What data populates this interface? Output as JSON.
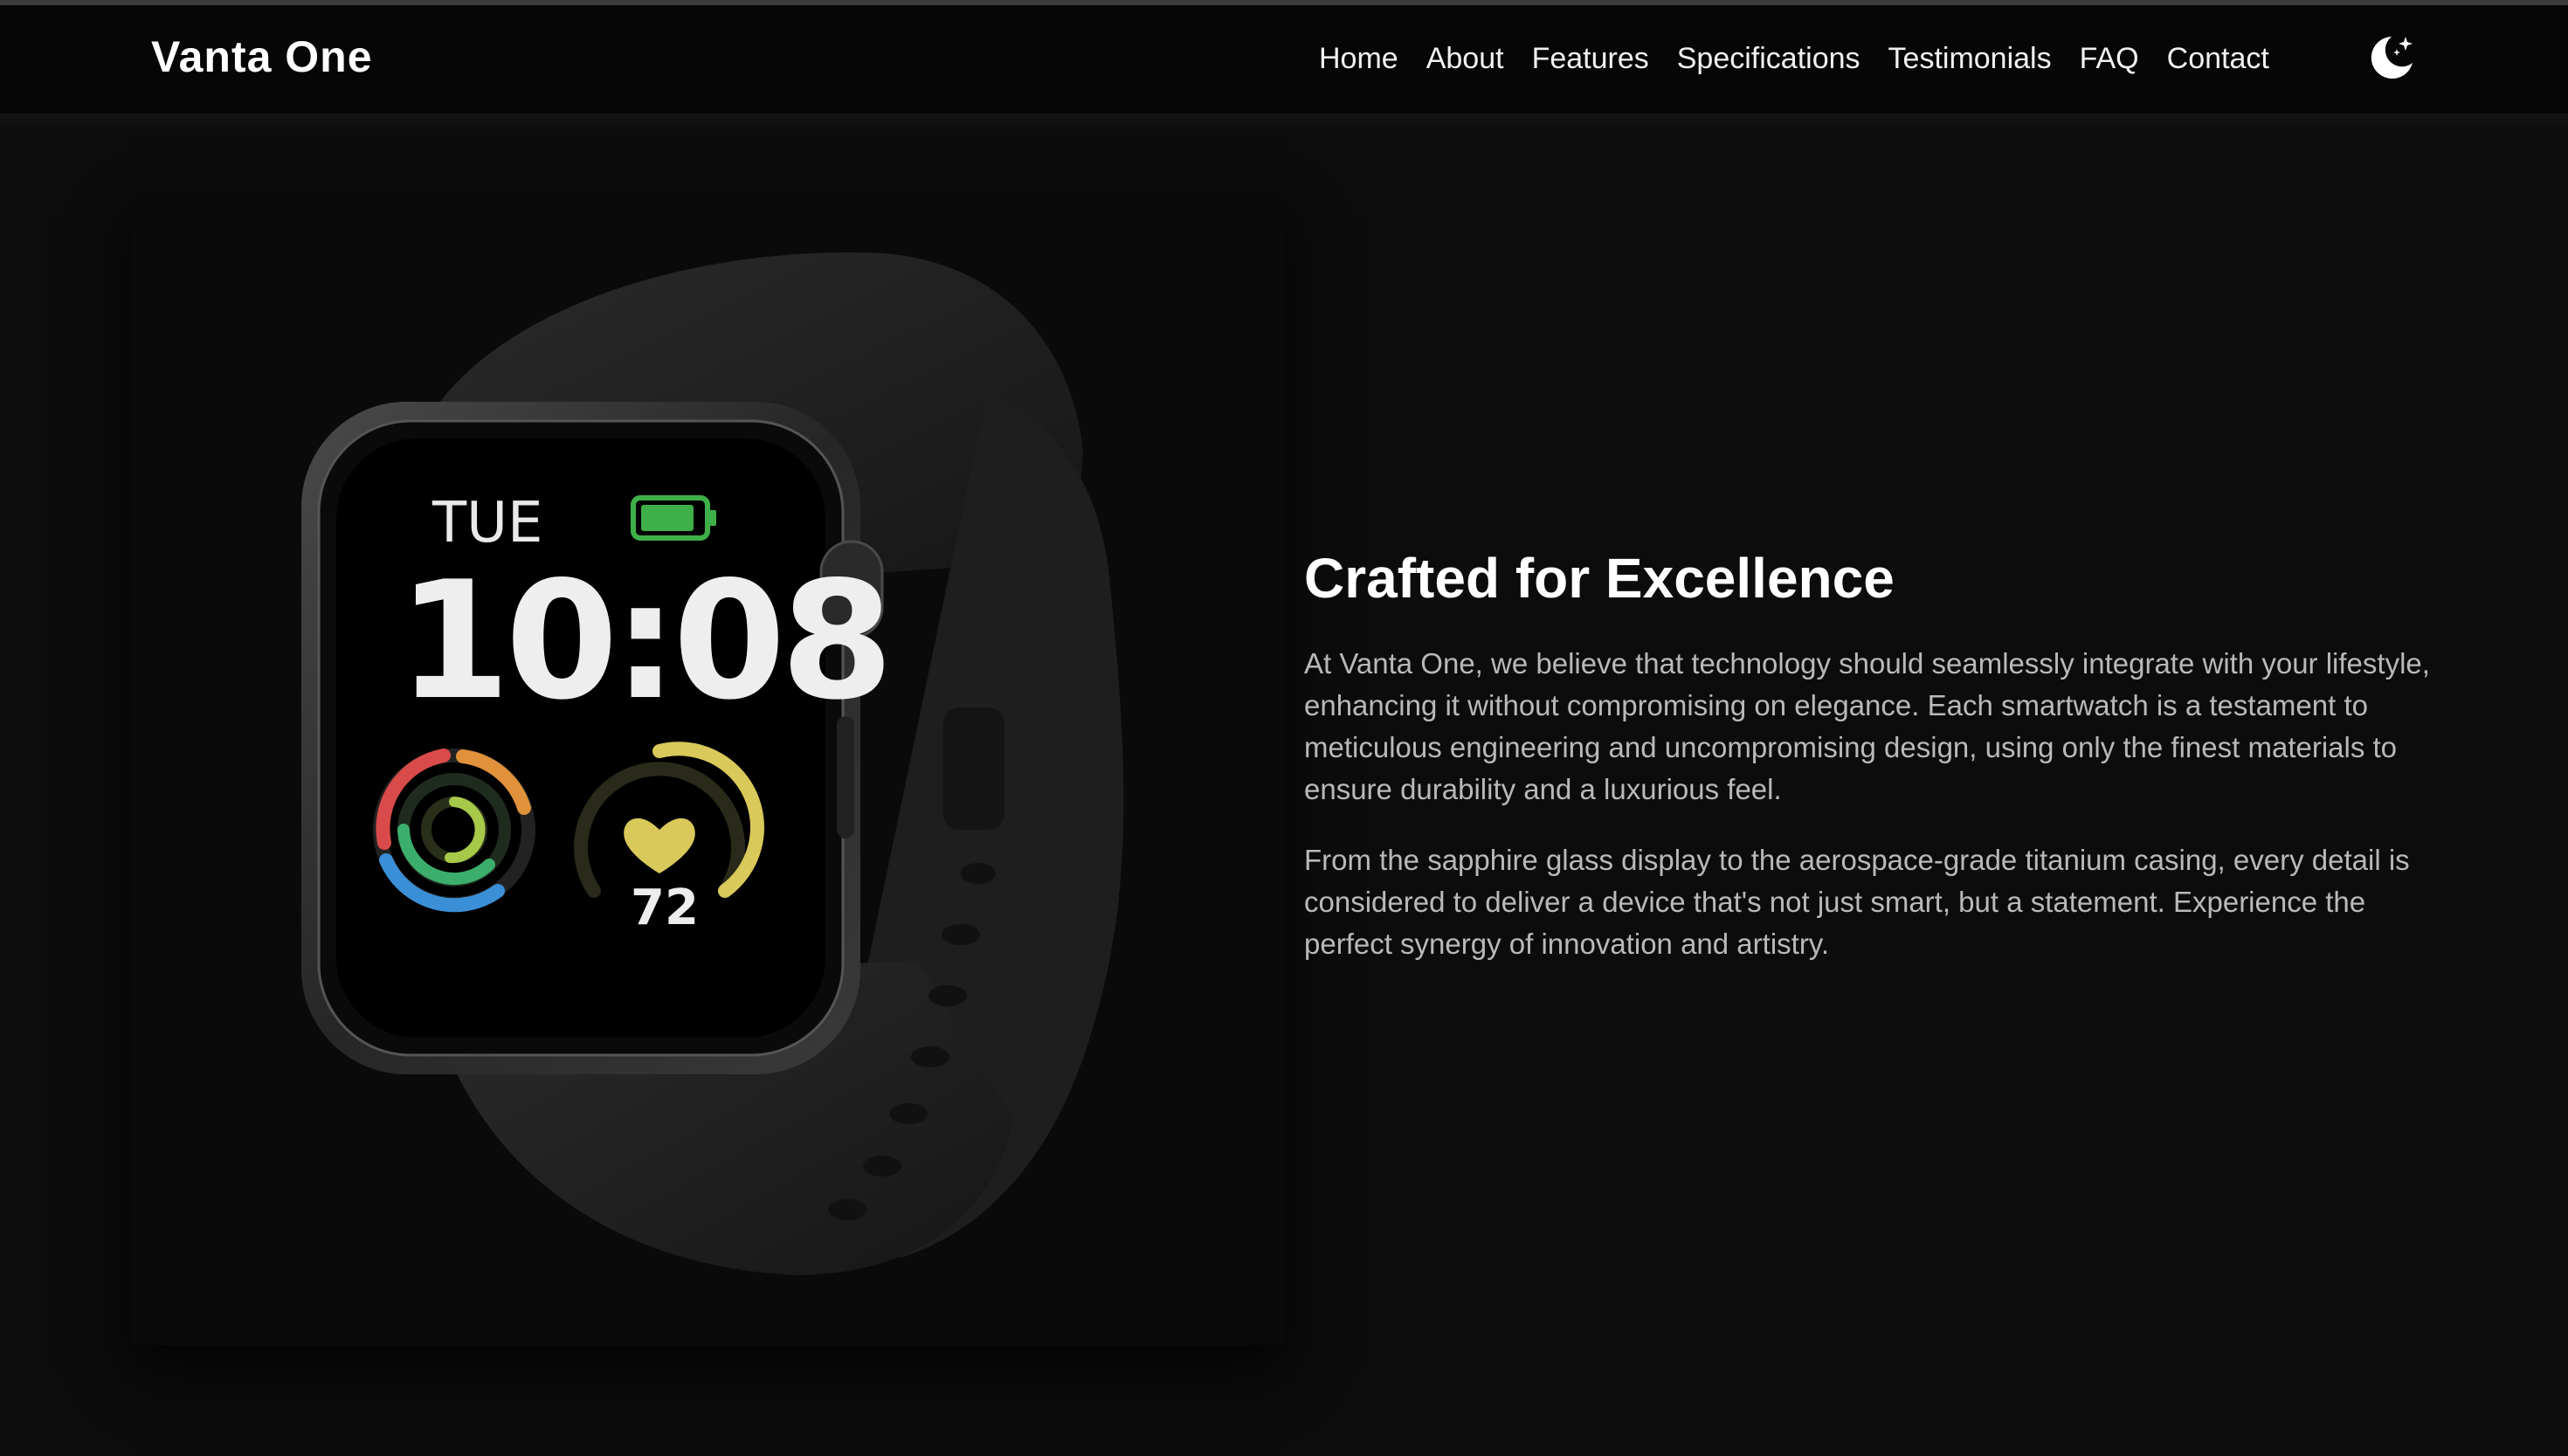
{
  "brand": {
    "name": "Vanta One"
  },
  "nav": {
    "links": [
      "Home",
      "About",
      "Features",
      "Specifications",
      "Testimonials",
      "FAQ",
      "Contact"
    ]
  },
  "theme_toggle": {
    "icon": "moon-stars-icon"
  },
  "hero_image": {
    "watch_face": {
      "day": "TUE",
      "time": "10:08",
      "heart_rate": "72"
    }
  },
  "about": {
    "title": "Crafted for Excellence",
    "paragraph_1": "At Vanta One, we believe that technology should seamlessly integrate with your lifestyle, enhancing it without compromising on elegance. Each smartwatch is a testament to meticulous engineering and uncompromising design, using only the finest materials to ensure durability and a luxurious feel.",
    "paragraph_2": "From the sapphire glass display to the aerospace-grade titanium casing, every detail is considered to deliver a device that's not just smart, but a statement. Experience the perfect synergy of innovation and artistry."
  },
  "colors": {
    "background": "#0c0c0c",
    "navbar": "#060606",
    "accent_battery": "#3fb049",
    "accent_heart": "#d9c85a"
  }
}
